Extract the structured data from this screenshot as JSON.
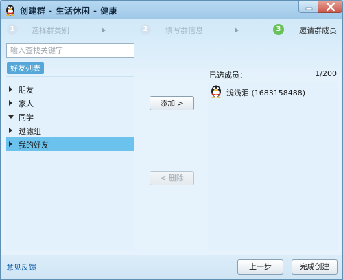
{
  "window": {
    "title": "创建群 - 生活休闲 - 健康",
    "icon": "qq-penguin-icon",
    "minimize_icon": "minimize-icon",
    "close_icon": "close-icon"
  },
  "steps": [
    {
      "num": "1",
      "label": "选择群类别",
      "active": false
    },
    {
      "num": "2",
      "label": "填写群信息",
      "active": false
    },
    {
      "num": "3",
      "label": "邀请群成员",
      "active": true
    }
  ],
  "search": {
    "placeholder": "输入查找关键字",
    "value": ""
  },
  "friends_tab": "好友列表",
  "tree": [
    {
      "label": "朋友",
      "expanded": false,
      "selected": false
    },
    {
      "label": "家人",
      "expanded": false,
      "selected": false
    },
    {
      "label": "同学",
      "expanded": true,
      "selected": false
    },
    {
      "label": "过滤组",
      "expanded": false,
      "selected": false
    },
    {
      "label": "我的好友",
      "expanded": false,
      "selected": true
    }
  ],
  "actions": {
    "add": "添加 >",
    "remove": "< 删除"
  },
  "selected": {
    "header": "已选成员：",
    "count": "1/200",
    "members": [
      {
        "name": "浅浅泪 (1683158488)",
        "avatar": "qq-penguin-icon"
      }
    ]
  },
  "footer": {
    "feedback": "意见反馈",
    "prev": "上一步",
    "finish": "完成创建"
  },
  "colors": {
    "selected_row": "#6bc2ed",
    "tab_bg": "#55a7d9",
    "active_step": "#69c15a",
    "link": "#0a5aa8"
  }
}
